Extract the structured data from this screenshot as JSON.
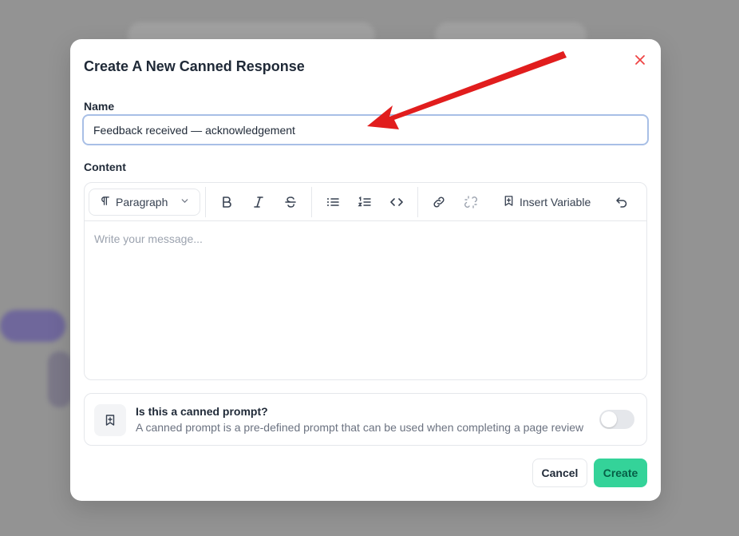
{
  "modal": {
    "title": "Create A New Canned Response",
    "close_icon": "close-icon"
  },
  "name_field": {
    "label": "Name",
    "value": "Feedback received — acknowledgement"
  },
  "content_field": {
    "label": "Content",
    "paragraph_select": "Paragraph",
    "insert_variable_label": "Insert Variable",
    "placeholder": "Write your message...",
    "toolbar_icons": [
      "paragraph-icon",
      "chevron-down-icon",
      "bold-icon",
      "italic-icon",
      "strikethrough-icon",
      "bullet-list-icon",
      "numbered-list-icon",
      "code-icon",
      "link-icon",
      "unlink-icon",
      "bookmark-plus-icon",
      "undo-icon"
    ]
  },
  "canned_prompt": {
    "title": "Is this a canned prompt?",
    "description": "A canned prompt is a pre-defined prompt that can be used when completing a page review",
    "enabled": false
  },
  "actions": {
    "cancel_label": "Cancel",
    "create_label": "Create"
  },
  "colors": {
    "accent": "#34d399",
    "close": "#ef4444",
    "annotation_arrow": "#e11d1d"
  }
}
